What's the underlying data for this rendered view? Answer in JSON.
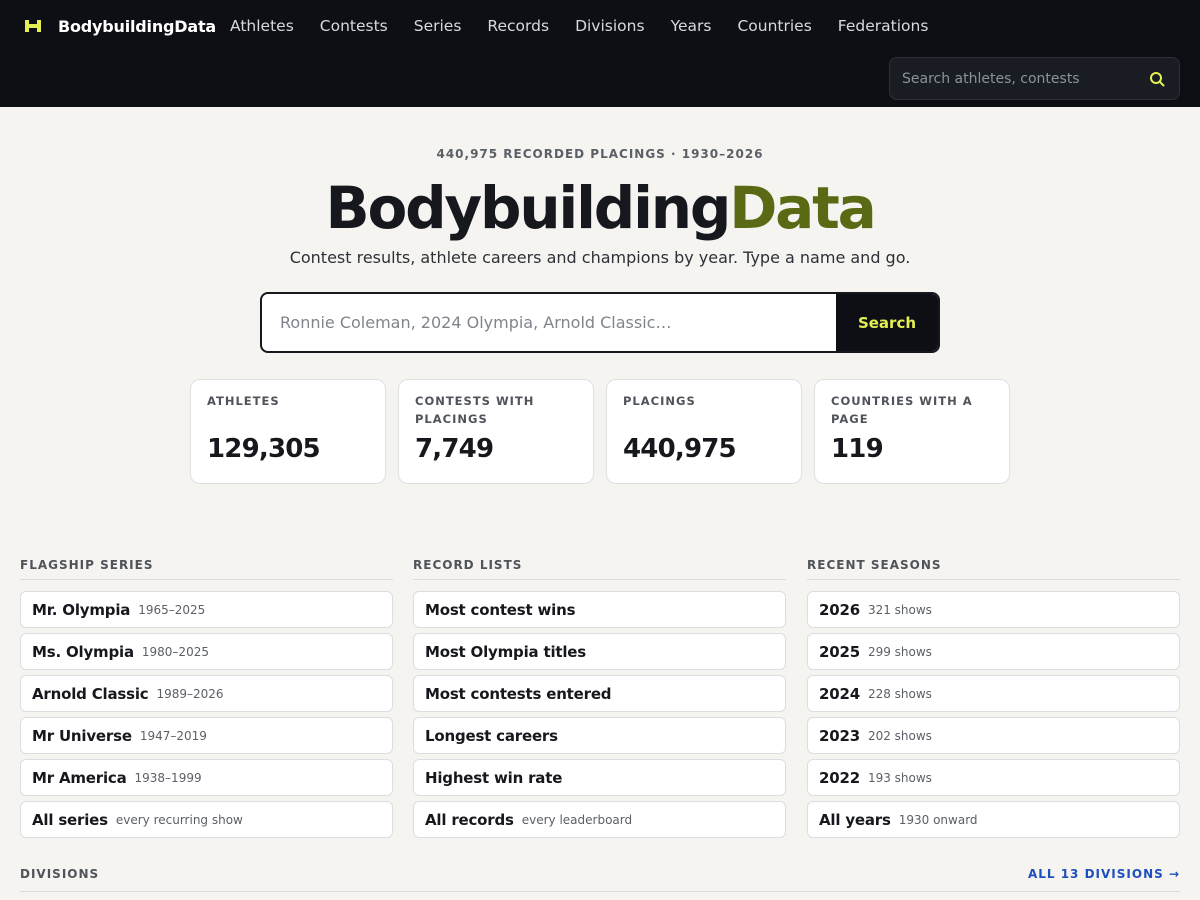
{
  "header": {
    "brand": "BodybuildingData",
    "nav": [
      "Athletes",
      "Contests",
      "Series",
      "Records",
      "Divisions",
      "Years",
      "Countries",
      "Federations"
    ],
    "search_placeholder": "Search athletes, contests"
  },
  "hero": {
    "eyebrow": "440,975 RECORDED PLACINGS · 1930–2026",
    "title_part1": "Bodybuilding",
    "title_part2": "Data",
    "tagline": "Contest results, athlete careers and champions by year. Type a name and go.",
    "search_placeholder": "Ronnie Coleman, 2024 Olympia, Arnold Classic…",
    "search_button": "Search"
  },
  "stats": [
    {
      "label": "ATHLETES",
      "value": "129,305"
    },
    {
      "label": "CONTESTS WITH PLACINGS",
      "value": "7,749"
    },
    {
      "label": "PLACINGS",
      "value": "440,975"
    },
    {
      "label": "COUNTRIES WITH A PAGE",
      "value": "119"
    }
  ],
  "flagship": {
    "heading": "FLAGSHIP SERIES",
    "items": [
      {
        "name": "Mr. Olympia",
        "sub": "1965–2025"
      },
      {
        "name": "Ms. Olympia",
        "sub": "1980–2025"
      },
      {
        "name": "Arnold Classic",
        "sub": "1989–2026"
      },
      {
        "name": "Mr Universe",
        "sub": "1947–2019"
      },
      {
        "name": "Mr America",
        "sub": "1938–1999"
      },
      {
        "name": "All series",
        "sub": "every recurring show"
      }
    ]
  },
  "records": {
    "heading": "RECORD LISTS",
    "items": [
      {
        "name": "Most contest wins",
        "sub": ""
      },
      {
        "name": "Most Olympia titles",
        "sub": ""
      },
      {
        "name": "Most contests entered",
        "sub": ""
      },
      {
        "name": "Longest careers",
        "sub": ""
      },
      {
        "name": "Highest win rate",
        "sub": ""
      },
      {
        "name": "All records",
        "sub": "every leaderboard"
      }
    ]
  },
  "seasons": {
    "heading": "RECENT SEASONS",
    "items": [
      {
        "name": "2026",
        "sub": "321 shows"
      },
      {
        "name": "2025",
        "sub": "299 shows"
      },
      {
        "name": "2024",
        "sub": "228 shows"
      },
      {
        "name": "2023",
        "sub": "202 shows"
      },
      {
        "name": "2022",
        "sub": "193 shows"
      },
      {
        "name": "All years",
        "sub": "1930 onward"
      }
    ]
  },
  "divisions": {
    "heading": "DIVISIONS",
    "all_link": "ALL 13 DIVISIONS →"
  },
  "colors": {
    "accent": "#e3ef52",
    "brand_green": "#5a6a14",
    "nav_bg": "#0d0f14",
    "link_blue": "#1f4fbf"
  }
}
